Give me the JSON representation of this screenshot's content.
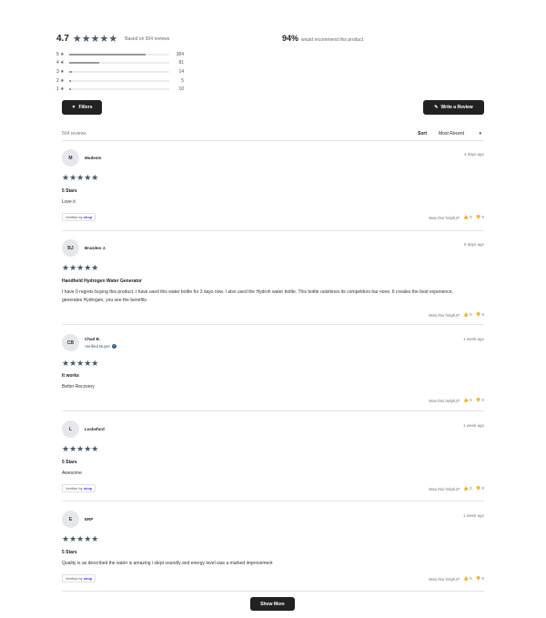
{
  "summary": {
    "average": "4.7",
    "stars": "★★★★★",
    "based_on": "Based on 504 reviews",
    "recommend_pct": "94%",
    "recommend_text": "would recommend this product"
  },
  "histogram": [
    {
      "label": "5",
      "count": "384",
      "fraction": 0.76
    },
    {
      "label": "4",
      "count": "81",
      "fraction": 0.3
    },
    {
      "label": "3",
      "count": "14",
      "fraction": 0.03
    },
    {
      "label": "2",
      "count": "5",
      "fraction": 0.02
    },
    {
      "label": "1",
      "count": "10",
      "fraction": 0.02
    }
  ],
  "toolbar": {
    "filters_label": "Filters",
    "filters_icon": "▼",
    "write_label": "Write a Review",
    "write_icon": "✎"
  },
  "list": {
    "count_label": "504 reviews",
    "sort_label": "Sort",
    "sort_value": "Most Recent",
    "sort_chevron": "▾"
  },
  "reviews": [
    {
      "initials": "M",
      "author": "Modesto",
      "verified_buyer": "",
      "date": "4 days ago",
      "stars": "★★★★★",
      "title": "5 Stars",
      "body": "Love it",
      "badge_prefix": "Verified by",
      "badge_brand": "shop",
      "helpful": "Was this helpful?",
      "up": "👍 0",
      "down": "👎 0"
    },
    {
      "initials": "BJ",
      "author": "Branden J.",
      "verified_buyer": "",
      "date": "6 days ago",
      "stars": "★★★★★",
      "title": "Handheld Hydrogen Water Generator",
      "body": "I have 0 regrets buying this product. I have used this water bottle for 3 days now. I also used the Hydroh water bottle. This bottle outshines its competitors bar none. It creates the best experience, generates Hydrogen, you see the benefits.",
      "badge_prefix": "",
      "badge_brand": "",
      "helpful": "Was this helpful?",
      "up": "👍 0",
      "down": "👎 0"
    },
    {
      "initials": "CB",
      "author": "Chad B.",
      "verified_buyer": "Verified Buyer",
      "date": "1 week ago",
      "stars": "★★★★★",
      "title": "It works",
      "body": "Better Recovery",
      "badge_prefix": "",
      "badge_brand": "",
      "helpful": "Was this helpful?",
      "up": "👍 0",
      "down": "👎 0"
    },
    {
      "initials": "L",
      "author": "Lockeford",
      "verified_buyer": "",
      "date": "1 week ago",
      "stars": "★★★★★",
      "title": "5 Stars",
      "body": "Awesome",
      "badge_prefix": "Verified by",
      "badge_brand": "shop",
      "helpful": "Was this helpful?",
      "up": "👍 0",
      "down": "👎 0"
    },
    {
      "initials": "E",
      "author": "ERP",
      "verified_buyer": "",
      "date": "1 week ago",
      "stars": "★★★★★",
      "title": "5 Stars",
      "body": "Quality is as described the water is amazing i slept soundly and energy level was a marked improvement",
      "badge_prefix": "Verified by",
      "badge_brand": "shop",
      "helpful": "Was this helpful?",
      "up": "👍 0",
      "down": "👎 0"
    }
  ],
  "footer": {
    "show_more_label": "Show More"
  },
  "colors": {
    "accent_dark": "#222222",
    "star": "#4a5a66",
    "shop_brand": "#5a31f4"
  }
}
